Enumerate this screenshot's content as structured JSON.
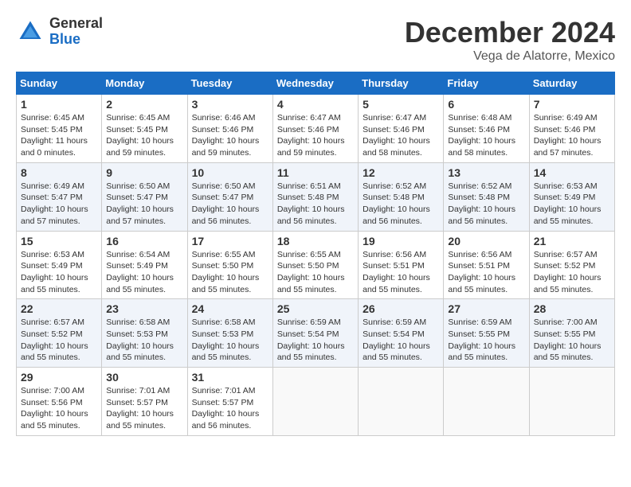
{
  "logo": {
    "general": "General",
    "blue": "Blue"
  },
  "title": "December 2024",
  "location": "Vega de Alatorre, Mexico",
  "days_of_week": [
    "Sunday",
    "Monday",
    "Tuesday",
    "Wednesday",
    "Thursday",
    "Friday",
    "Saturday"
  ],
  "weeks": [
    [
      {
        "day": "1",
        "info": "Sunrise: 6:45 AM\nSunset: 5:45 PM\nDaylight: 11 hours\nand 0 minutes."
      },
      {
        "day": "2",
        "info": "Sunrise: 6:45 AM\nSunset: 5:45 PM\nDaylight: 10 hours\nand 59 minutes."
      },
      {
        "day": "3",
        "info": "Sunrise: 6:46 AM\nSunset: 5:46 PM\nDaylight: 10 hours\nand 59 minutes."
      },
      {
        "day": "4",
        "info": "Sunrise: 6:47 AM\nSunset: 5:46 PM\nDaylight: 10 hours\nand 59 minutes."
      },
      {
        "day": "5",
        "info": "Sunrise: 6:47 AM\nSunset: 5:46 PM\nDaylight: 10 hours\nand 58 minutes."
      },
      {
        "day": "6",
        "info": "Sunrise: 6:48 AM\nSunset: 5:46 PM\nDaylight: 10 hours\nand 58 minutes."
      },
      {
        "day": "7",
        "info": "Sunrise: 6:49 AM\nSunset: 5:46 PM\nDaylight: 10 hours\nand 57 minutes."
      }
    ],
    [
      {
        "day": "8",
        "info": "Sunrise: 6:49 AM\nSunset: 5:47 PM\nDaylight: 10 hours\nand 57 minutes."
      },
      {
        "day": "9",
        "info": "Sunrise: 6:50 AM\nSunset: 5:47 PM\nDaylight: 10 hours\nand 57 minutes."
      },
      {
        "day": "10",
        "info": "Sunrise: 6:50 AM\nSunset: 5:47 PM\nDaylight: 10 hours\nand 56 minutes."
      },
      {
        "day": "11",
        "info": "Sunrise: 6:51 AM\nSunset: 5:48 PM\nDaylight: 10 hours\nand 56 minutes."
      },
      {
        "day": "12",
        "info": "Sunrise: 6:52 AM\nSunset: 5:48 PM\nDaylight: 10 hours\nand 56 minutes."
      },
      {
        "day": "13",
        "info": "Sunrise: 6:52 AM\nSunset: 5:48 PM\nDaylight: 10 hours\nand 56 minutes."
      },
      {
        "day": "14",
        "info": "Sunrise: 6:53 AM\nSunset: 5:49 PM\nDaylight: 10 hours\nand 55 minutes."
      }
    ],
    [
      {
        "day": "15",
        "info": "Sunrise: 6:53 AM\nSunset: 5:49 PM\nDaylight: 10 hours\nand 55 minutes."
      },
      {
        "day": "16",
        "info": "Sunrise: 6:54 AM\nSunset: 5:49 PM\nDaylight: 10 hours\nand 55 minutes."
      },
      {
        "day": "17",
        "info": "Sunrise: 6:55 AM\nSunset: 5:50 PM\nDaylight: 10 hours\nand 55 minutes."
      },
      {
        "day": "18",
        "info": "Sunrise: 6:55 AM\nSunset: 5:50 PM\nDaylight: 10 hours\nand 55 minutes."
      },
      {
        "day": "19",
        "info": "Sunrise: 6:56 AM\nSunset: 5:51 PM\nDaylight: 10 hours\nand 55 minutes."
      },
      {
        "day": "20",
        "info": "Sunrise: 6:56 AM\nSunset: 5:51 PM\nDaylight: 10 hours\nand 55 minutes."
      },
      {
        "day": "21",
        "info": "Sunrise: 6:57 AM\nSunset: 5:52 PM\nDaylight: 10 hours\nand 55 minutes."
      }
    ],
    [
      {
        "day": "22",
        "info": "Sunrise: 6:57 AM\nSunset: 5:52 PM\nDaylight: 10 hours\nand 55 minutes."
      },
      {
        "day": "23",
        "info": "Sunrise: 6:58 AM\nSunset: 5:53 PM\nDaylight: 10 hours\nand 55 minutes."
      },
      {
        "day": "24",
        "info": "Sunrise: 6:58 AM\nSunset: 5:53 PM\nDaylight: 10 hours\nand 55 minutes."
      },
      {
        "day": "25",
        "info": "Sunrise: 6:59 AM\nSunset: 5:54 PM\nDaylight: 10 hours\nand 55 minutes."
      },
      {
        "day": "26",
        "info": "Sunrise: 6:59 AM\nSunset: 5:54 PM\nDaylight: 10 hours\nand 55 minutes."
      },
      {
        "day": "27",
        "info": "Sunrise: 6:59 AM\nSunset: 5:55 PM\nDaylight: 10 hours\nand 55 minutes."
      },
      {
        "day": "28",
        "info": "Sunrise: 7:00 AM\nSunset: 5:55 PM\nDaylight: 10 hours\nand 55 minutes."
      }
    ],
    [
      {
        "day": "29",
        "info": "Sunrise: 7:00 AM\nSunset: 5:56 PM\nDaylight: 10 hours\nand 55 minutes."
      },
      {
        "day": "30",
        "info": "Sunrise: 7:01 AM\nSunset: 5:57 PM\nDaylight: 10 hours\nand 55 minutes."
      },
      {
        "day": "31",
        "info": "Sunrise: 7:01 AM\nSunset: 5:57 PM\nDaylight: 10 hours\nand 56 minutes."
      },
      {
        "day": "",
        "info": ""
      },
      {
        "day": "",
        "info": ""
      },
      {
        "day": "",
        "info": ""
      },
      {
        "day": "",
        "info": ""
      }
    ]
  ]
}
